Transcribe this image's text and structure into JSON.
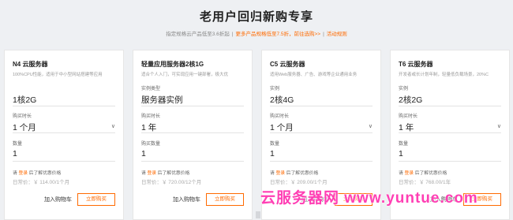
{
  "banner": {
    "title": "老用户回归新购专享",
    "sub_text": "指定规格云产品低至3.6折起",
    "sub_accent": "更多产品规格低至7.5折，前往选购>>",
    "sub_link": "活动规则"
  },
  "cards": [
    {
      "name": "N4 云服务器",
      "desc": "100%CPU性能，适用于中小型网站搭建等应用",
      "field1_label": "",
      "field1_value": "1核2G",
      "field2_label": "购买时长",
      "field2_value": "1 个月",
      "has_chevron": true,
      "field3_label": "数量",
      "field3_value": "1",
      "login_prefix": "请",
      "login_link": "登录",
      "login_suffix": "后了解优惠价格",
      "price": "日常价：￥ 114.00/1个月",
      "cart_label": "加入购物车",
      "buy_label": "立即购买"
    },
    {
      "name": "轻量应用服务器2核1G",
      "desc": "适合个人入门，可实现应用一键部署，极大优",
      "field1_label": "实例类型",
      "field1_value": "服务器实例",
      "field2_label": "购买时长",
      "field2_value": "1 年",
      "has_chevron": false,
      "field3_label": "购买数量",
      "field3_value": "1",
      "login_prefix": "请",
      "login_link": "登录",
      "login_suffix": "后了解优惠价格",
      "price": "日常价：￥ 720.00/12个月",
      "cart_label": "加入购物车",
      "buy_label": "立即购买"
    },
    {
      "name": "C5 云服务器",
      "desc": "适用Web服务器、广告、游戏等企业通用业务",
      "field1_label": "实例",
      "field1_value": "2核4G",
      "field2_label": "购买时长",
      "field2_value": "1 个月",
      "has_chevron": true,
      "field3_label": "数量",
      "field3_value": "1",
      "login_prefix": "请",
      "login_link": "登录",
      "login_suffix": "后了解优惠价格",
      "price": "日常价：￥ 209.00/1个月",
      "cart_label": "加入购物车",
      "buy_label": "立即购买"
    },
    {
      "name": "T6 云服务器",
      "desc": "开发者或长计划年制，轻量低负载场景，20%C",
      "field1_label": "实例",
      "field1_value": "2核2G",
      "field2_label": "购买时长",
      "field2_value": "1 年",
      "has_chevron": true,
      "field3_label": "数量",
      "field3_value": "1",
      "login_prefix": "请",
      "login_link": "登录",
      "login_suffix": "后了解优惠价格",
      "price": "日常价：￥ 768.00/1年",
      "cart_label": "加入购物车",
      "buy_label": "立即购买"
    }
  ],
  "watermark": "云服务器网 www.yuntue.com",
  "colors": {
    "accent": "#ff6a00",
    "watermark": "#ff3fb4",
    "background": "#eef0f3"
  }
}
